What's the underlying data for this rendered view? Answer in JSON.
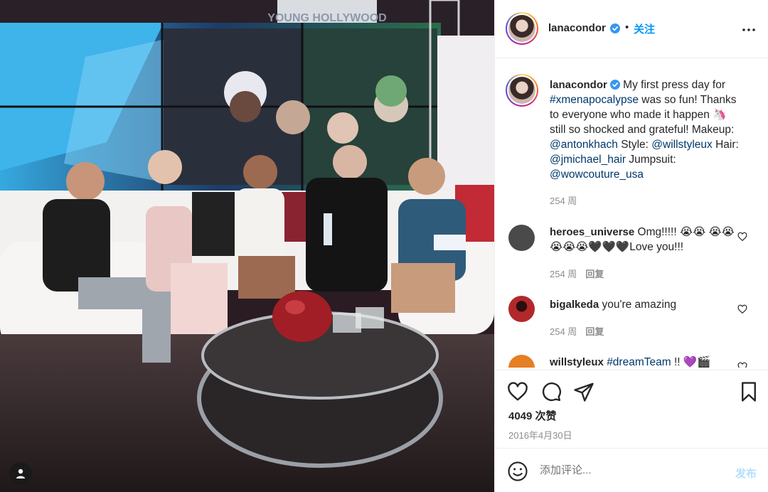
{
  "post": {
    "author": "lanacondor",
    "follow_label": "关注",
    "dot": "•"
  },
  "caption": {
    "username": "lanacondor",
    "parts": {
      "p1": " My first press day for ",
      "hashtag": "#xmenapocalypse",
      "p2": " was so fun! Thanks to everyone who made it happen 🦄 still so shocked and grateful! Makeup: ",
      "m1": "@antonkhach",
      "p3": " Style: ",
      "m2": "@willstyleux",
      "p4": " Hair: ",
      "m3": "@jmichael_hair",
      "p5": " Jumpsuit: ",
      "m4": "@wowcouture_usa"
    },
    "age": "254 周"
  },
  "comments": [
    {
      "username": "heroes_universe",
      "text": " Omg!!!!! 😭😭 😭😭😭😭😭🖤🖤🖤Love you!!!",
      "age": "254 周",
      "reply": "回复",
      "avatar_color": "#4a4a4a"
    },
    {
      "username": "bigalkeda",
      "text": " you're amazing",
      "age": "254 周",
      "reply": "回复",
      "avatar_color": "#b3282a"
    },
    {
      "username": "willstyleux",
      "hashtag": "#dreamTeam",
      "text": " !! 💜🎬",
      "avatar_color": "#e67e22"
    }
  ],
  "stats": {
    "likes": "4049 次赞",
    "date": "2016年4月30日"
  },
  "add_comment": {
    "placeholder": "添加评论...",
    "post_label": "发布"
  },
  "photo": {
    "sign_text": "YOUNG HOLLYWOOD"
  },
  "colors": {
    "link": "#00376b",
    "accent": "#0095f6",
    "verified": "#3897f0",
    "post_disabled": "#b2dffc"
  },
  "icons": [
    "heart-icon",
    "comment-icon",
    "share-icon",
    "bookmark-icon",
    "smiley-icon",
    "more-icon",
    "verified-icon",
    "user-tag-icon"
  ]
}
